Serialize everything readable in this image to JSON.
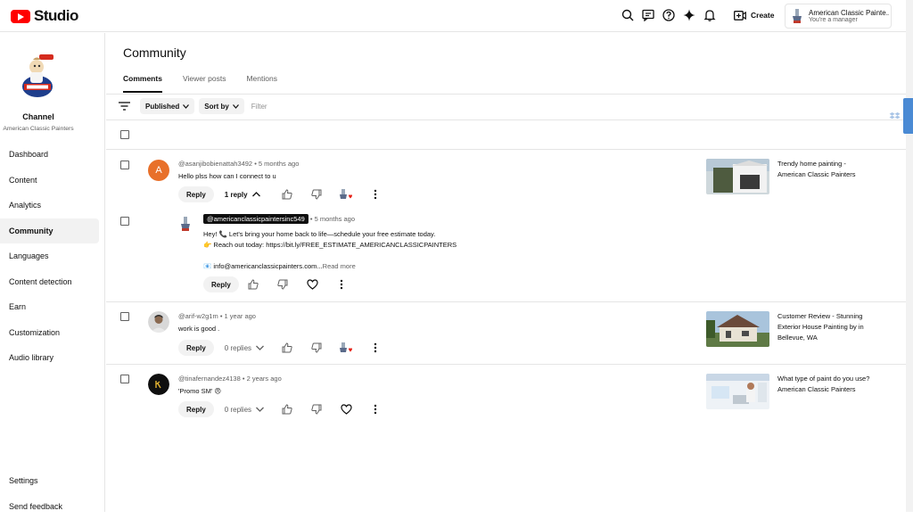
{
  "app": {
    "title": "Studio"
  },
  "header": {
    "create_label": "Create",
    "account_name": "American Classic Painte...",
    "account_role": "You're a manager"
  },
  "sidebar": {
    "channel_label": "Channel",
    "channel_name": "American Classic Painters",
    "items": [
      {
        "label": "Dashboard"
      },
      {
        "label": "Content"
      },
      {
        "label": "Analytics"
      },
      {
        "label": "Community",
        "active": true
      },
      {
        "label": "Languages"
      },
      {
        "label": "Content detection"
      },
      {
        "label": "Earn"
      },
      {
        "label": "Customization"
      },
      {
        "label": "Audio library"
      }
    ],
    "bottom_items": [
      {
        "label": "Settings"
      },
      {
        "label": "Send feedback"
      }
    ]
  },
  "page": {
    "title": "Community",
    "tabs": [
      {
        "label": "Comments",
        "active": true
      },
      {
        "label": "Viewer posts"
      },
      {
        "label": "Mentions"
      }
    ],
    "filters": {
      "published_label": "Published",
      "sort_label": "Sort by",
      "filter_placeholder": "Filter"
    }
  },
  "comments": [
    {
      "author": "@asanjibobienattah3492",
      "time": "5 months ago",
      "text": "Hello plss how can I connect to u",
      "avatar_letter": "A",
      "avatar_color": "#e8702a",
      "reply_label": "Reply",
      "replies_label": "1 reply",
      "video_title": "Trendy home painting - American Classic Painters"
    },
    {
      "author": "@arif-w2g1m",
      "time": "1 year ago",
      "text": "work is good .",
      "reply_label": "Reply",
      "replies_label": "0 replies",
      "video_title": "Customer Review - Stunning Exterior House Painting by in Bellevue, WA"
    },
    {
      "author": "@tinafernandez4138",
      "time": "2 years ago",
      "text": "'Promo SM' 😠",
      "reply_label": "Reply",
      "replies_label": "0 replies",
      "video_title": "What type of paint do you use? American Classic Painters"
    }
  ],
  "reply": {
    "author": "@americanclassicpaintersinc549",
    "time": "5 months ago",
    "line1": "Hey! 📞 Let's bring your home back to life—schedule your free estimate today.",
    "line2": "👉 Reach out today: https://bit.ly/FREE_ESTIMATE_AMERICANCLASSICPAINTERS",
    "line3": "📧 info@americanclassicpainters.com...",
    "read_more": "Read more",
    "reply_label": "Reply"
  },
  "colors": {
    "brand_red": "#ff0000",
    "accent_blue": "#4a8ad4"
  }
}
